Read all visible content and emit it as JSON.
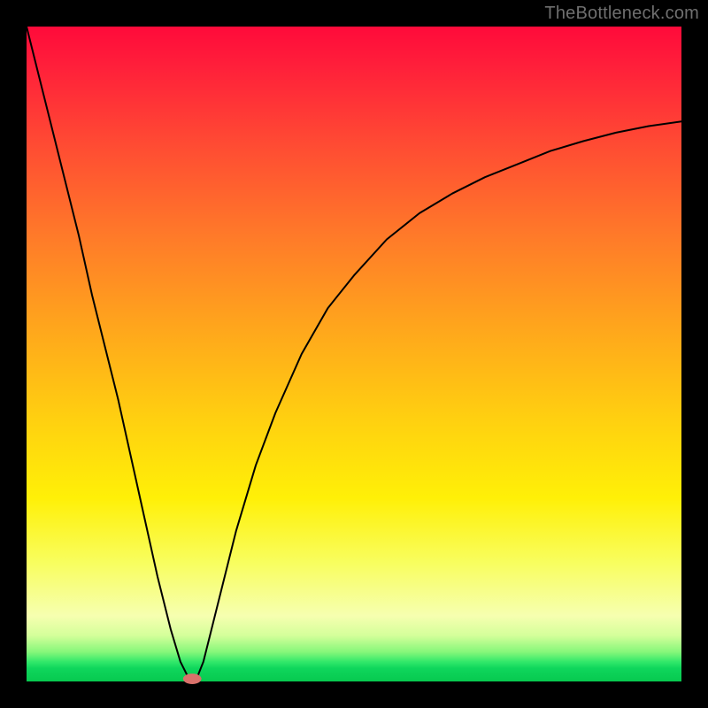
{
  "watermark": "TheBottleneck.com",
  "chart_data": {
    "type": "line",
    "title": "",
    "xlabel": "",
    "ylabel": "",
    "xlim": [
      0,
      100
    ],
    "ylim": [
      0,
      100
    ],
    "grid": false,
    "legend": false,
    "series": [
      {
        "name": "curve",
        "x": [
          0,
          2,
          4,
          6,
          8,
          10,
          12,
          14,
          16,
          18,
          20,
          22,
          23.5,
          25,
          26,
          27,
          28,
          30,
          32,
          35,
          38,
          42,
          46,
          50,
          55,
          60,
          65,
          70,
          75,
          80,
          85,
          90,
          95,
          100
        ],
        "y": [
          100,
          92,
          84,
          76,
          68,
          59,
          51,
          43,
          34,
          25,
          16,
          8,
          3,
          0,
          0.5,
          3,
          7,
          15,
          23,
          33,
          41,
          50,
          57,
          62,
          67.5,
          71.5,
          74.5,
          77,
          79,
          81,
          82.5,
          83.8,
          84.8,
          85.5
        ]
      }
    ],
    "marker": {
      "x": 25.3,
      "y": 0.4,
      "rx": 1.4,
      "ry": 0.8
    },
    "colors": {
      "curve_stroke": "#000000",
      "marker_fill": "#d9716b",
      "bg_top": "#ff0a3a",
      "bg_bottom": "#07c94f"
    }
  }
}
